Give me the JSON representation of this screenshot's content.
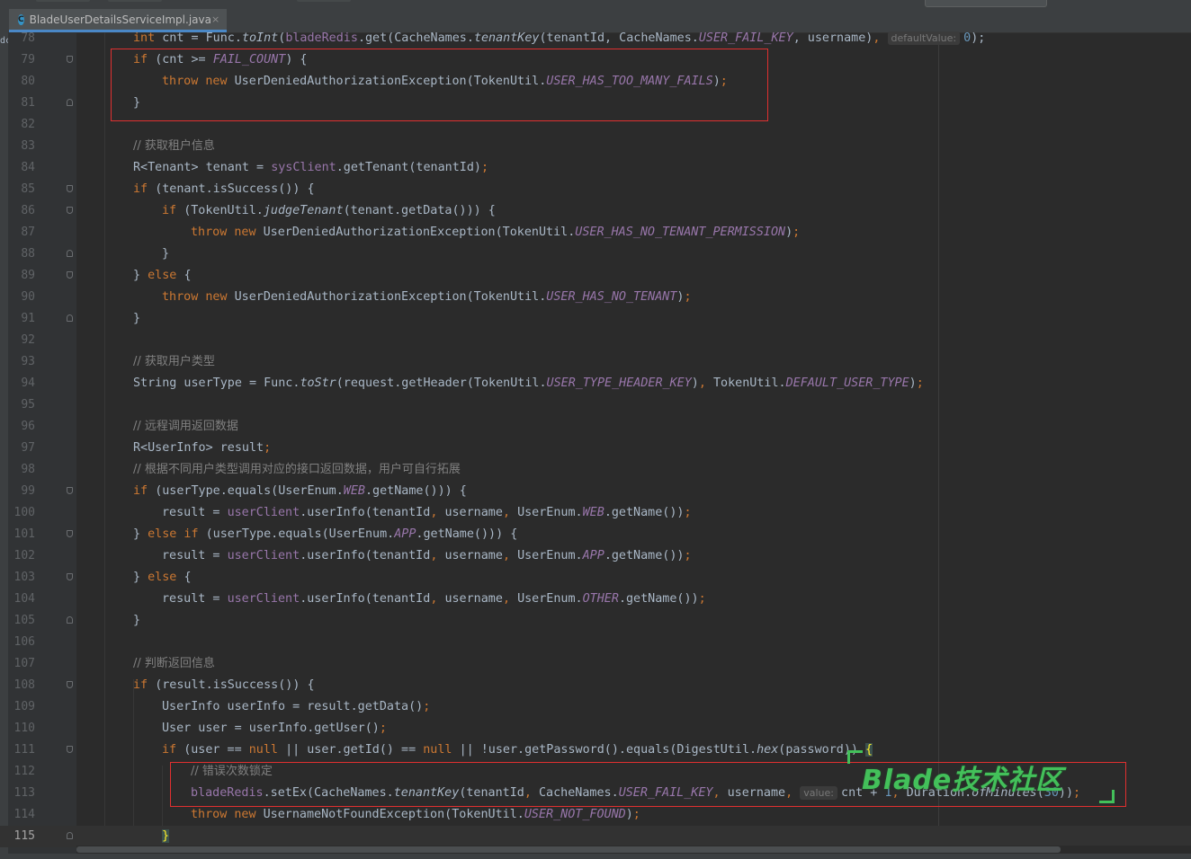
{
  "tab": {
    "label": "BladeUserDetailsServiceImpl.java",
    "icon": "class-icon",
    "icon_letter": "C",
    "close": "×"
  },
  "left_edge_text": "dc",
  "watermark": "Blade技术社区",
  "lines": [
    {
      "n": "78",
      "tokens": [
        [
          "int ",
          "kw"
        ],
        [
          "cnt = Func.",
          ""
        ],
        [
          "toInt",
          "it"
        ],
        [
          "(",
          ""
        ],
        [
          "bladeRedis",
          "fld"
        ],
        [
          ".get(CacheNames.",
          ""
        ],
        [
          "tenantKey",
          "it"
        ],
        [
          "(tenantId, CacheNames.",
          ""
        ],
        [
          "USER_FAIL_KEY",
          "st"
        ],
        [
          ", username)",
          ""
        ],
        [
          ", ",
          "kw"
        ],
        [
          "defaultValue:",
          "hint"
        ],
        [
          "0",
          "num"
        ],
        [
          ");",
          ""
        ]
      ]
    },
    {
      "n": "79",
      "tokens": [
        [
          "if ",
          "kw"
        ],
        [
          "(cnt >= ",
          ""
        ],
        [
          "FAIL_COUNT",
          "st"
        ],
        [
          ") {",
          ""
        ]
      ]
    },
    {
      "n": "80",
      "indent": 1,
      "tokens": [
        [
          "throw new ",
          "kw"
        ],
        [
          "UserDeniedAuthorizationException(TokenUtil.",
          ""
        ],
        [
          "USER_HAS_TOO_MANY_FAILS",
          "st"
        ],
        [
          ")",
          ""
        ],
        [
          ";",
          "kw"
        ]
      ]
    },
    {
      "n": "81",
      "tokens": [
        [
          "}",
          ""
        ]
      ]
    },
    {
      "n": "82",
      "tokens": []
    },
    {
      "n": "83",
      "tokens": [
        [
          "// 获取租户信息",
          "cm"
        ]
      ]
    },
    {
      "n": "84",
      "tokens": [
        [
          "R<Tenant> tenant = ",
          ""
        ],
        [
          "sysClient",
          "fld"
        ],
        [
          ".getTenant(tenantId)",
          ""
        ],
        [
          ";",
          "kw"
        ]
      ]
    },
    {
      "n": "85",
      "tokens": [
        [
          "if ",
          "kw"
        ],
        [
          "(tenant.isSuccess()) {",
          ""
        ]
      ]
    },
    {
      "n": "86",
      "indent": 1,
      "tokens": [
        [
          "if ",
          "kw"
        ],
        [
          "(TokenUtil.",
          ""
        ],
        [
          "judgeTenant",
          "it"
        ],
        [
          "(tenant.getData())) {",
          ""
        ]
      ]
    },
    {
      "n": "87",
      "indent": 2,
      "tokens": [
        [
          "throw new ",
          "kw"
        ],
        [
          "UserDeniedAuthorizationException(TokenUtil.",
          ""
        ],
        [
          "USER_HAS_NO_TENANT_PERMISSION",
          "st"
        ],
        [
          ")",
          ""
        ],
        [
          ";",
          "kw"
        ]
      ]
    },
    {
      "n": "88",
      "indent": 1,
      "tokens": [
        [
          "}",
          ""
        ]
      ]
    },
    {
      "n": "89",
      "tokens": [
        [
          "} ",
          ""
        ],
        [
          "else ",
          "kw"
        ],
        [
          "{",
          ""
        ]
      ]
    },
    {
      "n": "90",
      "indent": 1,
      "tokens": [
        [
          "throw new ",
          "kw"
        ],
        [
          "UserDeniedAuthorizationException(TokenUtil.",
          ""
        ],
        [
          "USER_HAS_NO_TENANT",
          "st"
        ],
        [
          ")",
          ""
        ],
        [
          ";",
          "kw"
        ]
      ]
    },
    {
      "n": "91",
      "tokens": [
        [
          "}",
          ""
        ]
      ]
    },
    {
      "n": "92",
      "tokens": []
    },
    {
      "n": "93",
      "tokens": [
        [
          "// 获取用户类型",
          "cm"
        ]
      ]
    },
    {
      "n": "94",
      "tokens": [
        [
          "String userType = Func.",
          ""
        ],
        [
          "toStr",
          "it"
        ],
        [
          "(request.getHeader(TokenUtil.",
          ""
        ],
        [
          "USER_TYPE_HEADER_KEY",
          "st"
        ],
        [
          ")",
          ""
        ],
        [
          ", ",
          "kw"
        ],
        [
          "TokenUtil.",
          ""
        ],
        [
          "DEFAULT_USER_TYPE",
          "st"
        ],
        [
          ")",
          ""
        ],
        [
          ";",
          "kw"
        ]
      ]
    },
    {
      "n": "95",
      "tokens": []
    },
    {
      "n": "96",
      "tokens": [
        [
          "// 远程调用返回数据",
          "cm"
        ]
      ]
    },
    {
      "n": "97",
      "tokens": [
        [
          "R<UserInfo> result",
          ""
        ],
        [
          ";",
          "kw"
        ]
      ]
    },
    {
      "n": "98",
      "tokens": [
        [
          "// 根据不同用户类型调用对应的接口返回数据，用户可自行拓展",
          "cm"
        ]
      ]
    },
    {
      "n": "99",
      "tokens": [
        [
          "if ",
          "kw"
        ],
        [
          "(userType.equals(UserEnum.",
          ""
        ],
        [
          "WEB",
          "st"
        ],
        [
          ".getName())) {",
          ""
        ]
      ]
    },
    {
      "n": "100",
      "indent": 1,
      "tokens": [
        [
          "result = ",
          ""
        ],
        [
          "userClient",
          "fld"
        ],
        [
          ".userInfo(tenantId",
          ""
        ],
        [
          ", ",
          "kw"
        ],
        [
          "username",
          ""
        ],
        [
          ", ",
          "kw"
        ],
        [
          "UserEnum.",
          ""
        ],
        [
          "WEB",
          "st"
        ],
        [
          ".getName())",
          ""
        ],
        [
          ";",
          "kw"
        ]
      ]
    },
    {
      "n": "101",
      "tokens": [
        [
          "} ",
          ""
        ],
        [
          "else if ",
          "kw"
        ],
        [
          "(userType.equals(UserEnum.",
          ""
        ],
        [
          "APP",
          "st"
        ],
        [
          ".getName())) {",
          ""
        ]
      ]
    },
    {
      "n": "102",
      "indent": 1,
      "tokens": [
        [
          "result = ",
          ""
        ],
        [
          "userClient",
          "fld"
        ],
        [
          ".userInfo(tenantId",
          ""
        ],
        [
          ", ",
          "kw"
        ],
        [
          "username",
          ""
        ],
        [
          ", ",
          "kw"
        ],
        [
          "UserEnum.",
          ""
        ],
        [
          "APP",
          "st"
        ],
        [
          ".getName())",
          ""
        ],
        [
          ";",
          "kw"
        ]
      ]
    },
    {
      "n": "103",
      "tokens": [
        [
          "} ",
          ""
        ],
        [
          "else ",
          "kw"
        ],
        [
          "{",
          ""
        ]
      ]
    },
    {
      "n": "104",
      "indent": 1,
      "tokens": [
        [
          "result = ",
          ""
        ],
        [
          "userClient",
          "fld"
        ],
        [
          ".userInfo(tenantId",
          ""
        ],
        [
          ", ",
          "kw"
        ],
        [
          "username",
          ""
        ],
        [
          ", ",
          "kw"
        ],
        [
          "UserEnum.",
          ""
        ],
        [
          "OTHER",
          "st"
        ],
        [
          ".getName())",
          ""
        ],
        [
          ";",
          "kw"
        ]
      ]
    },
    {
      "n": "105",
      "tokens": [
        [
          "}",
          ""
        ]
      ]
    },
    {
      "n": "106",
      "tokens": []
    },
    {
      "n": "107",
      "tokens": [
        [
          "// 判断返回信息",
          "cm"
        ]
      ]
    },
    {
      "n": "108",
      "tokens": [
        [
          "if ",
          "kw"
        ],
        [
          "(result.isSuccess()) {",
          ""
        ]
      ]
    },
    {
      "n": "109",
      "indent": 1,
      "tokens": [
        [
          "UserInfo userInfo = result.getData()",
          ""
        ],
        [
          ";",
          "kw"
        ]
      ]
    },
    {
      "n": "110",
      "indent": 1,
      "tokens": [
        [
          "User user = userInfo.getUser()",
          ""
        ],
        [
          ";",
          "kw"
        ]
      ]
    },
    {
      "n": "111",
      "indent": 1,
      "tokens": [
        [
          "if ",
          "kw"
        ],
        [
          "(user == ",
          ""
        ],
        [
          "null ",
          "kw"
        ],
        [
          "|| user.getId() == ",
          ""
        ],
        [
          "null ",
          "kw"
        ],
        [
          "|| !user.getPassword().equals(DigestUtil.",
          ""
        ],
        [
          "hex",
          "it"
        ],
        [
          "(password))",
          ""
        ],
        [
          " ",
          ""
        ],
        [
          "{",
          "brace"
        ]
      ]
    },
    {
      "n": "112",
      "indent": 2,
      "tokens": [
        [
          "// 错误次数锁定",
          "cm"
        ]
      ]
    },
    {
      "n": "113",
      "indent": 2,
      "tokens": [
        [
          "bladeRedis",
          "fld"
        ],
        [
          ".setEx(CacheNames.",
          ""
        ],
        [
          "tenantKey",
          "it"
        ],
        [
          "(tenantId",
          ""
        ],
        [
          ", ",
          "kw"
        ],
        [
          "CacheNames.",
          ""
        ],
        [
          "USER_FAIL_KEY",
          "st"
        ],
        [
          ", ",
          "kw"
        ],
        [
          "username",
          ""
        ],
        [
          ", ",
          "kw"
        ],
        [
          "value:",
          "hint"
        ],
        [
          "cnt + ",
          ""
        ],
        [
          "1",
          "num"
        ],
        [
          ", ",
          "kw"
        ],
        [
          "Duration.",
          ""
        ],
        [
          "ofMinutes",
          "it"
        ],
        [
          "(",
          ""
        ],
        [
          "30",
          "num"
        ],
        [
          "))",
          ""
        ],
        [
          ";",
          "kw"
        ]
      ]
    },
    {
      "n": "114",
      "indent": 2,
      "tokens": [
        [
          "throw new ",
          "kw"
        ],
        [
          "UsernameNotFoundException(TokenUtil.",
          ""
        ],
        [
          "USER_NOT_FOUND",
          "st"
        ],
        [
          ")",
          ""
        ],
        [
          ";",
          "kw"
        ]
      ]
    },
    {
      "n": "115",
      "indent": 1,
      "current": true,
      "tokens": [
        [
          "}",
          "brace"
        ]
      ]
    }
  ]
}
